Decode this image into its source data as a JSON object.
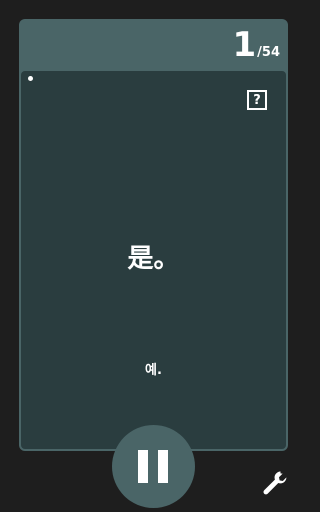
{
  "counter": {
    "current": "1",
    "total": "/54"
  },
  "card": {
    "help_label": "?",
    "question": "是。",
    "answer": "예."
  },
  "controls": {
    "pause_icon": "pause-icon",
    "settings_icon": "wrench-icon"
  },
  "colors": {
    "background": "#1e1e1e",
    "card_outer": "#4a6567",
    "card_inner": "#2a3d3f",
    "text": "#ffffff"
  }
}
